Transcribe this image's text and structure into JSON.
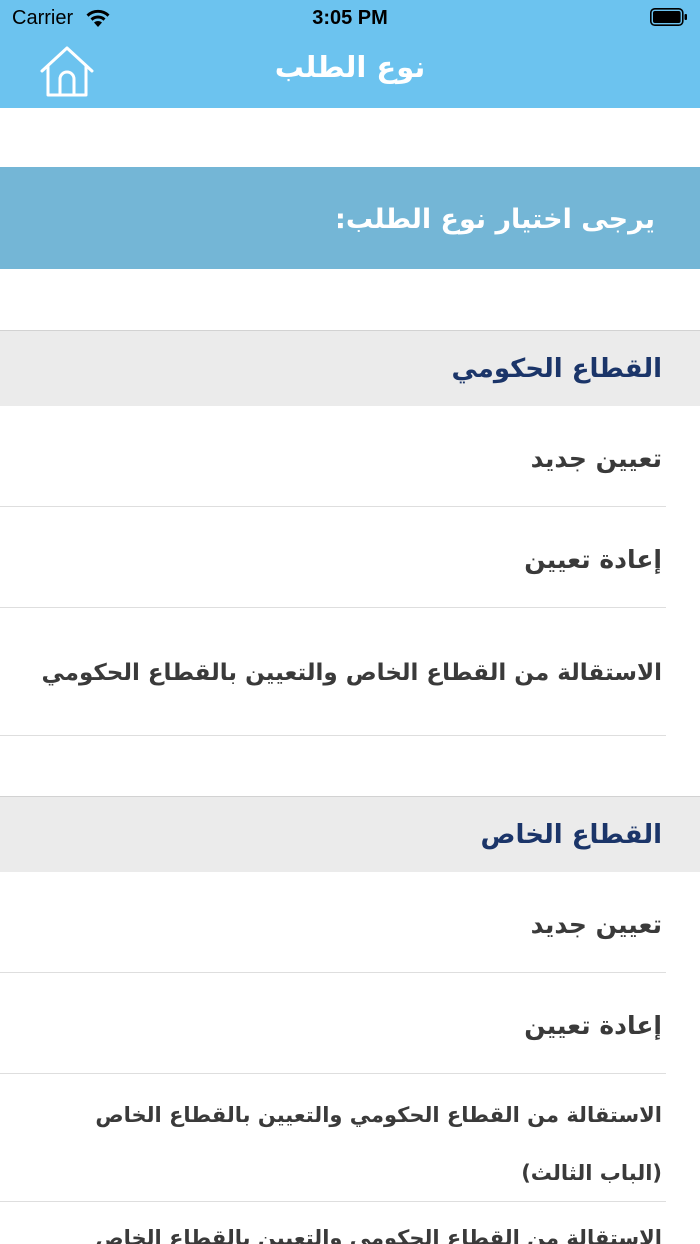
{
  "status_bar": {
    "carrier": "Carrier",
    "time": "3:05 PM"
  },
  "nav": {
    "title": "نوع الطلب",
    "home_icon": "home-icon"
  },
  "prompt": "يرجى اختيار نوع الطلب:",
  "sections": [
    {
      "title": "القطاع الحكومي",
      "items": [
        "تعيين جديد",
        "إعادة تعيين",
        "الاستقالة من القطاع الخاص والتعيين بالقطاع الحكومي"
      ]
    },
    {
      "title": "القطاع الخاص",
      "items": [
        "تعيين جديد",
        "إعادة تعيين",
        "الاستقالة من القطاع الحكومي والتعيين بالقطاع الخاص (الباب الثالث)",
        "الاستقالة من القطاع الحكومي والتعيين بالقطاع الخاص"
      ]
    }
  ],
  "colors": {
    "header": "#6cc3ef",
    "prompt_bar": "#74b6d6",
    "section_bg": "#ebebeb",
    "section_title": "#1b3569"
  }
}
